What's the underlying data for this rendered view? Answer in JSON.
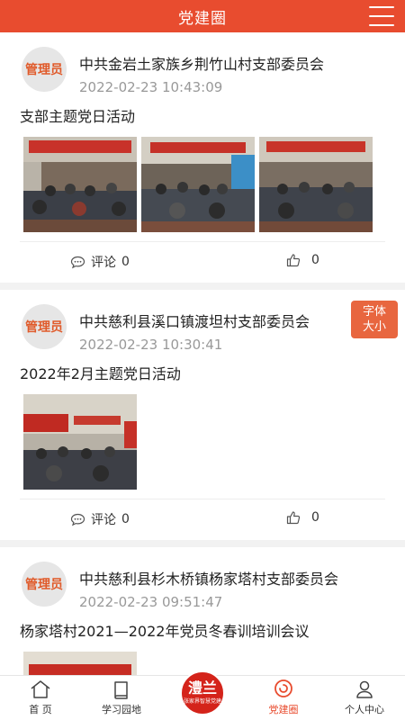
{
  "header": {
    "title": "党建圈"
  },
  "font_size_button": {
    "line1": "字体",
    "line2": "大小"
  },
  "posts": [
    {
      "avatar_label": "管理员",
      "author": "中共金岩土家族乡荆竹山村支部委员会",
      "time": "2022-02-23 10:43:09",
      "text": "支部主题党日活动",
      "photo_count": 3,
      "comment_label": "评论",
      "comment_count": "0",
      "like_count": "0"
    },
    {
      "avatar_label": "管理员",
      "author": "中共慈利县溪口镇渡坦村支部委员会",
      "time": "2022-02-23 10:30:41",
      "text": "2022年2月主题党日活动",
      "photo_count": 1,
      "comment_label": "评论",
      "comment_count": "0",
      "like_count": "0"
    },
    {
      "avatar_label": "管理员",
      "author": "中共慈利县杉木桥镇杨家塔村支部委员会",
      "time": "2022-02-23 09:51:47",
      "text": "杨家塔村2021—2022年党员冬春训培训会议",
      "photo_count": 1
    }
  ],
  "tabbar": {
    "home": "首 页",
    "study": "学习园地",
    "logo_big": "澧兰",
    "logo_small": "张家界智慧党建",
    "circle": "党建圈",
    "profile": "个人中心"
  },
  "colors": {
    "brand": "#e84c2f",
    "active_tab": "#e84c2f",
    "avatar_text": "#e05a2a"
  }
}
